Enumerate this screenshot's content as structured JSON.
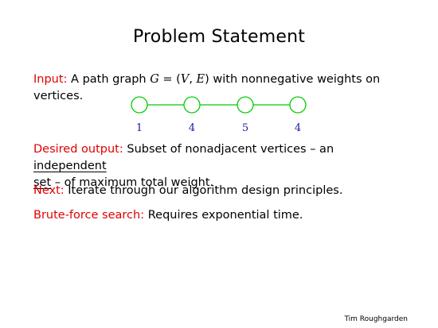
{
  "title": "Problem Statement",
  "input": {
    "label": "Input:",
    "text_before": "A path graph",
    "math_G": "G",
    "math_eq": " = (",
    "math_V": "V",
    "math_comma": ", ",
    "math_E": "E",
    "math_close": ")",
    "text_after": "with nonnegative weights on",
    "line2": "vertices."
  },
  "graph": {
    "weights": [
      "1",
      "4",
      "5",
      "4"
    ],
    "node_color": "#00cc00",
    "weight_color": "#1a1aa6"
  },
  "desired_output": {
    "label": "Desired output:",
    "text1": "Subset of nonadjacent vertices – an",
    "term1": "independent",
    "term2": "set",
    "text2": "– of maximum total weight."
  },
  "next": {
    "label": "Next:",
    "text": "Iterate through our algorithm design principles."
  },
  "brute_force": {
    "label": "Brute-force search:",
    "text": "Requires exponential time."
  },
  "footer": "Tim Roughgarden",
  "accent_color": "#e00000"
}
